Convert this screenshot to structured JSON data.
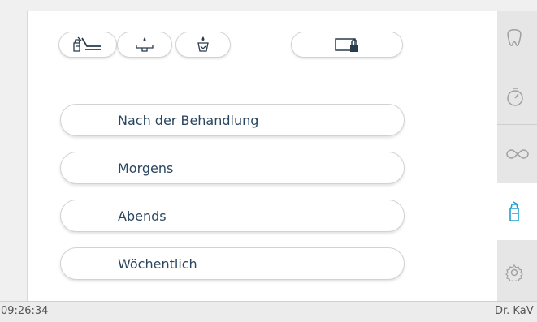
{
  "menu": {
    "items": [
      {
        "label": "Nach der Behandlung"
      },
      {
        "label": "Morgens"
      },
      {
        "label": "Abends"
      },
      {
        "label": "Wöchentlich"
      }
    ]
  },
  "toolbar": {
    "icons": [
      "spray-treatment-icon",
      "basin-drop-icon",
      "cup-drop-icon",
      "lock-screen-icon"
    ]
  },
  "sidebar": {
    "items": [
      {
        "icon": "tooth-icon",
        "active": false
      },
      {
        "icon": "stopwatch-icon",
        "active": false
      },
      {
        "icon": "infinity-icon",
        "active": false
      },
      {
        "icon": "spray-bottle-icon",
        "active": true
      },
      {
        "icon": "gear-icon",
        "active": false
      }
    ]
  },
  "status": {
    "time": "09:26:34",
    "user": "Dr. KaV"
  },
  "colors": {
    "accent": "#1f9fd6",
    "text": "#2a4660",
    "icon": "#2a3b4c",
    "sidebar_icon": "#a0a0a0"
  }
}
